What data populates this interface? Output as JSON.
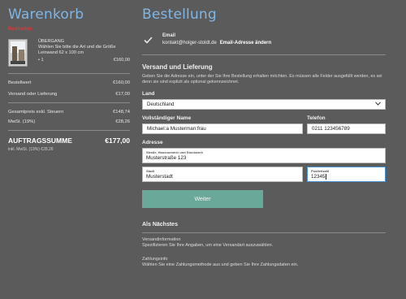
{
  "cart": {
    "title": "Warenkorb",
    "edit_label": "Bearbeiten",
    "product": {
      "name": "ÜBERGANG",
      "description": "Wählen Sie bitte die Art und die Größe",
      "size": "Leinwand 62 x 100 cm",
      "qty": "• 1",
      "price": "€160,00"
    },
    "rows": [
      {
        "label": "Bestellwert",
        "value": "€160,00"
      },
      {
        "label": "Versand oder Lieferung",
        "value": "€17,00"
      }
    ],
    "rows2": [
      {
        "label": "Gesamtpreis exkl. Steuern",
        "value": "€148,74"
      },
      {
        "label": "MwSt. (19%)",
        "value": "€28,26"
      }
    ],
    "total_label": "AUFTRAGSSUMME",
    "total_value": "€177,00",
    "tax_note": "inkl. MwSt. (19%) €28,26"
  },
  "order": {
    "title": "Bestellung",
    "email_label": "Email",
    "email_value": "kontakt@holger-stoldt.de",
    "email_change": "Email-Adresse ändern",
    "shipping_title": "Versand und Lieferung",
    "shipping_desc": "Geben Sie die Adresse ein, unter der Sie Ihre Bestellung erhalten möchten. Es müssen alle Felder ausgefüllt werden, es sei denn sie sind explizit als optional gekennzeichnet.",
    "country_label": "Land",
    "country_value": "Deutschland",
    "name_label": "Vollständiger Name",
    "name_value": "Michael:a Musterman:frau",
    "phone_label": "Telefon",
    "phone_value": "0211 123456789",
    "address_label": "Adresse",
    "street_label": "Straße, Hausnummer und Stockwerk",
    "street_value": "Musterstraße 123",
    "city_label": "Stadt",
    "city_value": "Musterstadt",
    "zip_label": "Postleitzahl",
    "zip_value": "12345",
    "continue_label": "Weiter",
    "next_title": "Als Nächstes",
    "steps": [
      {
        "title": "Versandinformation",
        "desc": "Spezifizieren Sie Ihre Angaben, um eine Versandart auszuwählen."
      },
      {
        "title": "Zahlungsinfo",
        "desc": "Wählen Sie eine Zahlungsmethode aus und geben Sie Ihre Zahlungsdaten ein."
      }
    ]
  },
  "icons": {
    "check": "check-icon",
    "dropdown": "chevron-down-icon"
  },
  "colors": {
    "background": "#5b5b5b",
    "heading": "#7fb6e6",
    "accent_button": "#6aa89a",
    "edit_link": "#ff3030",
    "focus_border": "#4a90d9"
  }
}
